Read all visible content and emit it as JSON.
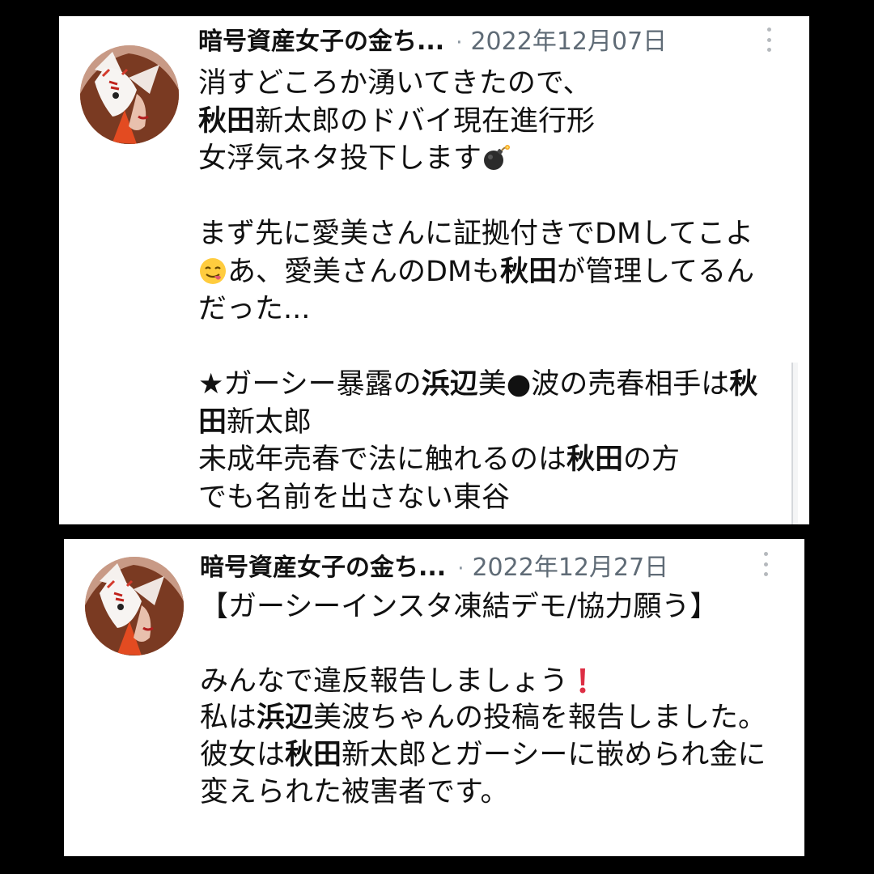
{
  "posts": [
    {
      "author": "暗号資産女子の金ち...",
      "separator": "·",
      "date": "2022年12月07日",
      "lines": [
        [
          {
            "t": "消すどころか湧いてきたので、"
          }
        ],
        [
          {
            "t": "秋田",
            "b": true
          },
          {
            "t": "新太郎のドバイ現在進行形"
          }
        ],
        [
          {
            "t": "女浮気ネタ投下します"
          },
          {
            "emoji": "bomb-emoji"
          }
        ],
        [],
        [
          {
            "t": "まず先に愛美さんに証拠付きでDMしてこよ"
          }
        ],
        [
          {
            "emoji": "yum-face-emoji"
          },
          {
            "t": "あ、愛美さんのDMも"
          },
          {
            "t": "秋田",
            "b": true
          },
          {
            "t": "が管理してるん"
          }
        ],
        [
          {
            "t": "だった..."
          }
        ],
        [],
        [
          {
            "t": "★ガーシー暴露の"
          },
          {
            "t": "浜辺",
            "b": true
          },
          {
            "t": "美●波の売春相手は"
          },
          {
            "t": "秋",
            "b": true
          }
        ],
        [
          {
            "t": "田",
            "b": true
          },
          {
            "t": "新太郎"
          }
        ],
        [
          {
            "t": "未成年売春で法に触れるのは"
          },
          {
            "t": "秋田",
            "b": true
          },
          {
            "t": "の方"
          }
        ],
        [
          {
            "t": "でも名前を出さない東谷"
          }
        ]
      ]
    },
    {
      "author": "暗号資産女子の金ち...",
      "separator": "·",
      "date": "2022年12月27日",
      "lines": [
        [
          {
            "t": "【ガーシーインスタ凍結デモ/協力願う】"
          }
        ],
        [],
        [
          {
            "t": "みんなで違反報告しましょう"
          },
          {
            "emoji": "exclamation-emoji"
          }
        ],
        [
          {
            "t": "私は"
          },
          {
            "t": "浜辺",
            "b": true
          },
          {
            "t": "美波ちゃんの投稿を報告しました。"
          }
        ],
        [
          {
            "t": "彼女は"
          },
          {
            "t": "秋田",
            "b": true
          },
          {
            "t": "新太郎とガーシーに嵌められ金に"
          }
        ],
        [
          {
            "t": "変えられた被害者です。"
          }
        ]
      ]
    }
  ]
}
